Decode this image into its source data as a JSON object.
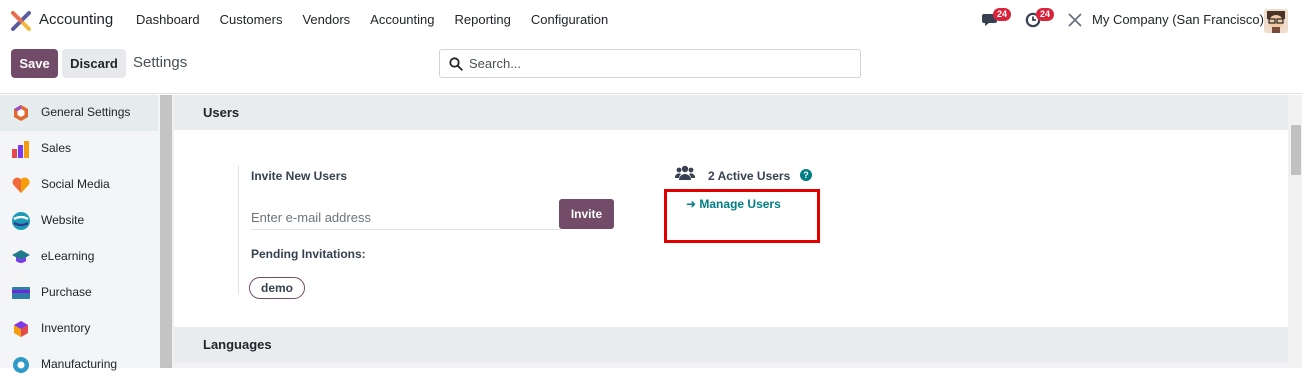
{
  "navbar": {
    "app_name": "Accounting",
    "menu": [
      "Dashboard",
      "Customers",
      "Vendors",
      "Accounting",
      "Reporting",
      "Configuration"
    ],
    "messages_badge": "24",
    "activities_badge": "24",
    "company": "My Company (San Francisco)",
    "icons": {
      "messages": "chat-icon",
      "activities": "clock-icon",
      "debug": "tools-icon"
    }
  },
  "control_panel": {
    "save_label": "Save",
    "discard_label": "Discard",
    "title": "Settings",
    "search_placeholder": "Search..."
  },
  "sidebar": {
    "items": [
      {
        "label": "General Settings",
        "icon": "general-settings-icon",
        "active": true
      },
      {
        "label": "Sales",
        "icon": "sales-icon"
      },
      {
        "label": "Social Media",
        "icon": "social-media-icon"
      },
      {
        "label": "Website",
        "icon": "website-icon"
      },
      {
        "label": "eLearning",
        "icon": "elearning-icon"
      },
      {
        "label": "Purchase",
        "icon": "purchase-icon"
      },
      {
        "label": "Inventory",
        "icon": "inventory-icon"
      },
      {
        "label": "Manufacturing",
        "icon": "manufacturing-icon"
      }
    ]
  },
  "users_section": {
    "title": "Users",
    "invite_title": "Invite New Users",
    "email_placeholder": "Enter e-mail address",
    "invite_button": "Invite",
    "pending_title": "Pending Invitations:",
    "pending": [
      "demo"
    ],
    "active_users": "2 Active Users",
    "manage_users": "Manage Users"
  },
  "languages_section": {
    "title": "Languages"
  },
  "colors": {
    "brand": "#714b67",
    "link": "#017e84",
    "badge": "#d9233b",
    "highlight": "#e00000"
  }
}
